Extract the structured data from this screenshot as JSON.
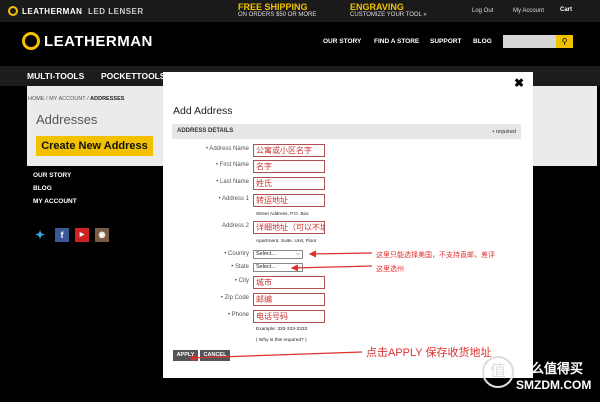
{
  "topbar": {
    "brand": "LEATHERMAN",
    "brand2": "LED LENSER",
    "promo1_title": "FREE SHIPPING",
    "promo1_sub": "ON ORDERS $50 OR MORE",
    "promo2_title": "ENGRAVING",
    "promo2_sub": "CUSTOMIZE YOUR TOOL »",
    "logout": "Log Out",
    "account": "My Account",
    "cart": "Cart"
  },
  "header": {
    "logo": "LEATHERMAN",
    "nav": [
      "OUR STORY",
      "FIND A STORE",
      "SUPPORT",
      "BLOG"
    ]
  },
  "categories": [
    "MULTI-TOOLS",
    "POCKETTOOLS"
  ],
  "breadcrumb": [
    "HOME",
    "MY ACCOUNT",
    "ADDRESSES"
  ],
  "page_title": "Addresses",
  "create_button": "Create New Address",
  "sidebar_links": [
    "OUR STORY",
    "BLOG",
    "MY ACCOUNT"
  ],
  "modal": {
    "title": "Add Address",
    "section": "ADDRESS DETAILS",
    "required": "• required",
    "fields": {
      "address_name": {
        "label": "• Address Name",
        "value": "公寓或小区名字"
      },
      "first_name": {
        "label": "• First Name",
        "value": "名字"
      },
      "last_name": {
        "label": "• Last Name",
        "value": "姓氏"
      },
      "address1": {
        "label": "• Address 1",
        "value": "转运地址",
        "hint": "Street Address, P.O. Box"
      },
      "address2": {
        "label": "Address 2",
        "value": "详细地址（可以不填",
        "hint": "Apartment, Suite, Unit, Floor"
      },
      "country": {
        "label": "• Country",
        "value": "Select..."
      },
      "state": {
        "label": "• State",
        "value": "Select..."
      },
      "city": {
        "label": "• City",
        "value": "城市"
      },
      "zip": {
        "label": "• Zip Code",
        "value": "邮编"
      },
      "phone": {
        "label": "• Phone",
        "value": "电话号码",
        "hint": "Example: 333-333-3333",
        "hint2": "( Why is this required? )"
      }
    },
    "apply": "APPLY",
    "cancel": "CANCEL"
  },
  "annotations": {
    "country_note": "这里只能选择美国，不支持直邮，差评",
    "state_note": "这里选州",
    "apply_note": "点击APPLY 保存收货地址"
  },
  "watermark": {
    "top": "什么值得买",
    "bottom": "SMZDM.COM"
  },
  "colors": {
    "accent": "#f2c200",
    "annotation": "#e03030"
  }
}
